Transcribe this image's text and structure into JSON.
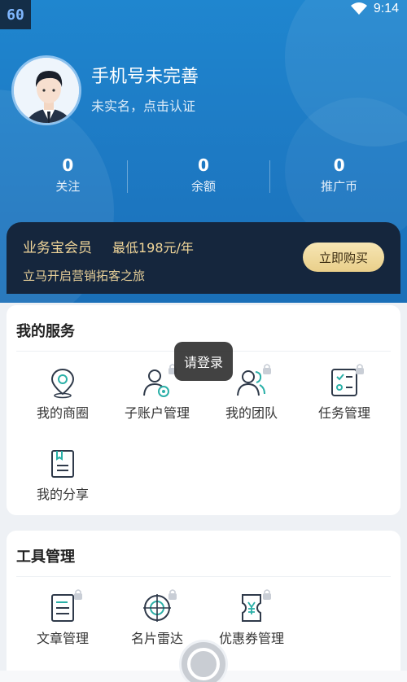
{
  "status_bar": {
    "fps_badge": "60",
    "time": "9:14"
  },
  "profile": {
    "title": "手机号未完善",
    "subtitle": "未实名，点击认证"
  },
  "stats": [
    {
      "value": "0",
      "label": "关注"
    },
    {
      "value": "0",
      "label": "余额"
    },
    {
      "value": "0",
      "label": "推广币"
    }
  ],
  "membership": {
    "title": "业务宝会员",
    "price": "最低198元/年",
    "subtitle": "立马开启营销拓客之旅",
    "buy_label": "立即购买"
  },
  "services": {
    "title": "我的服务",
    "items": [
      {
        "label": "我的商圈",
        "icon": "location-pin-icon",
        "locked": false
      },
      {
        "label": "子账户管理",
        "icon": "user-settings-icon",
        "locked": true
      },
      {
        "label": "我的团队",
        "icon": "team-icon",
        "locked": true
      },
      {
        "label": "任务管理",
        "icon": "task-checklist-icon",
        "locked": true
      },
      {
        "label": "我的分享",
        "icon": "share-book-icon",
        "locked": false
      }
    ]
  },
  "tools": {
    "title": "工具管理",
    "items": [
      {
        "label": "文章管理",
        "icon": "article-icon",
        "locked": true
      },
      {
        "label": "名片雷达",
        "icon": "radar-icon",
        "locked": true
      },
      {
        "label": "优惠券管理",
        "icon": "coupon-icon",
        "locked": true
      }
    ]
  },
  "toast": {
    "text": "请登录"
  },
  "colors": {
    "header_blue": "#1f86cf",
    "gold": "#f2d79a",
    "dark_card": "#15263d",
    "icon_stroke": "#2f3a4a"
  }
}
